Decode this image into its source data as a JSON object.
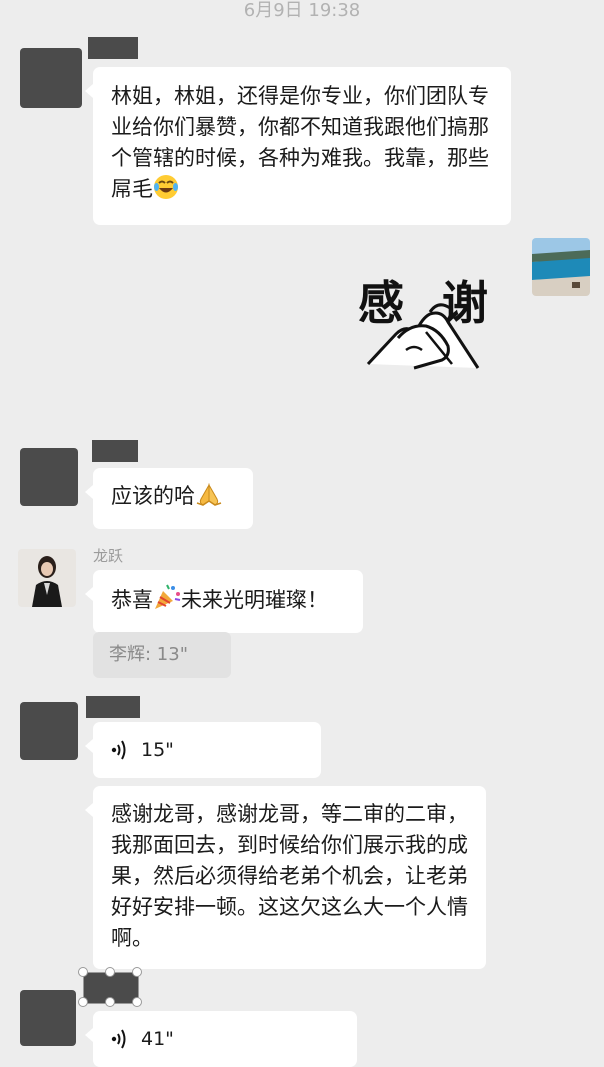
{
  "header": {
    "timestamp": "6月9日 19:38"
  },
  "messages": {
    "m1_text": "林姐，林姐，还得是你专业，你们团队专业给你们暴赞，你都不知道我跟他们搞那个管辖的时候，各种为难我。我靠，那些屌毛",
    "m1_emoji": "tears-of-joy-emoji",
    "sticker_text_left": "感",
    "sticker_text_right": "谢",
    "m2_text": "应该的哈",
    "m2_emoji": "pray-emoji",
    "longyue_name": "龙跃",
    "m3_text_before": "恭喜",
    "m3_emoji": "party-popper-emoji",
    "m3_text_after": "未来光明璀璨！",
    "m3_quote": "李辉: 13\"",
    "m4_voice": "15\"",
    "m5_text": "感谢龙哥，感谢龙哥，等二审的二审，我那面回去，到时候给你们展示我的成果，然后必须得给老弟个机会，让老弟好好安排一顿。这这欠这么大一个人情啊。",
    "m6_voice": "41\""
  },
  "colors": {
    "background": "#ededed",
    "bubble": "#ffffff",
    "redaction": "#4b4b4b",
    "timestamp": "#b2b2b2"
  }
}
